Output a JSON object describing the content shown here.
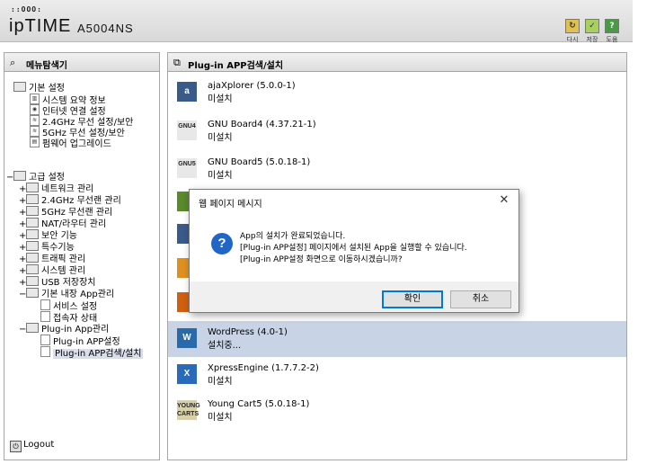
{
  "header": {
    "logo_dots": "::OOO:",
    "logo_brand": "ipTIME",
    "logo_model": "A5004NS",
    "buttons": [
      {
        "label": "다시",
        "icon": "refresh-icon",
        "color": "#c9a43a"
      },
      {
        "label": "저장",
        "icon": "save-icon",
        "color": "#8ab848"
      },
      {
        "label": "도움",
        "icon": "help-icon",
        "color": "#3e8a3a"
      }
    ]
  },
  "sidebar": {
    "title": "메뉴탐색기",
    "basic": {
      "label": "기본 설정",
      "items": [
        "시스템 요약 정보",
        "인터넷 연결 설정",
        "2.4GHz 무선 설정/보안",
        "5GHz 무선 설정/보안",
        "펌웨어 업그레이드"
      ]
    },
    "advanced": {
      "label": "고급 설정",
      "items": [
        "네트워크 관리",
        "2.4GHz 무선랜 관리",
        "5GHz 무선랜 관리",
        "NAT/라우터 관리",
        "보안 기능",
        "특수기능",
        "트래픽 관리",
        "시스템 관리",
        "USB 저장장치"
      ],
      "builtin_app": {
        "label": "기본 내장 App관리",
        "items": [
          "서비스 설정",
          "접속자 상태"
        ]
      },
      "plugin_app": {
        "label": "Plug-in App관리",
        "items": [
          "Plug-in APP설정",
          "Plug-in APP검색/설치"
        ]
      }
    },
    "logout": "Logout"
  },
  "main": {
    "title": "Plug-in APP검색/설치",
    "plugins": [
      {
        "name": "ajaXplorer (5.0.0-1)",
        "status": "미설치",
        "icon_text": "a",
        "color": "#3a5a8a"
      },
      {
        "name": "GNU Board4 (4.37.21-1)",
        "status": "미설치",
        "icon_text": "GNU4",
        "color": "#e8e8e8"
      },
      {
        "name": "GNU Board5 (5.0.18-1)",
        "status": "미설치",
        "icon_text": "GNU5",
        "color": "#e8e8e8"
      },
      {
        "name": "",
        "status": "",
        "icon_text": "",
        "color": "#5a8a2a"
      },
      {
        "name": "",
        "status": "",
        "icon_text": "",
        "color": "#3a5a8a"
      },
      {
        "name": "",
        "status": "",
        "icon_text": "",
        "color": "#e09020"
      },
      {
        "name": "",
        "status": "",
        "icon_text": "",
        "color": "#d06010"
      },
      {
        "name": "WordPress (4.0-1)",
        "status": "설치중...",
        "icon_text": "W",
        "color": "#2a6aa8",
        "selected": true
      },
      {
        "name": "XpressEngine (1.7.7.2-2)",
        "status": "미설치",
        "icon_text": "X",
        "color": "#2a6ab8"
      },
      {
        "name": "Young Cart5 (5.0.18-1)",
        "status": "미설치",
        "icon_text": "YOUNG CARTS",
        "color": "#d8d0a8"
      }
    ]
  },
  "dialog": {
    "title": "웹 페이지 메시지",
    "icon": "question-icon",
    "lines": [
      "App의 설치가 완료되었습니다.",
      "[Plug-in APP설정] 페이지에서 설치된 App을 실행할 수 있습니다.",
      "[Plug-in APP설정 화면으로 이동하시겠습니까?"
    ],
    "ok_label": "확인",
    "cancel_label": "취소"
  }
}
